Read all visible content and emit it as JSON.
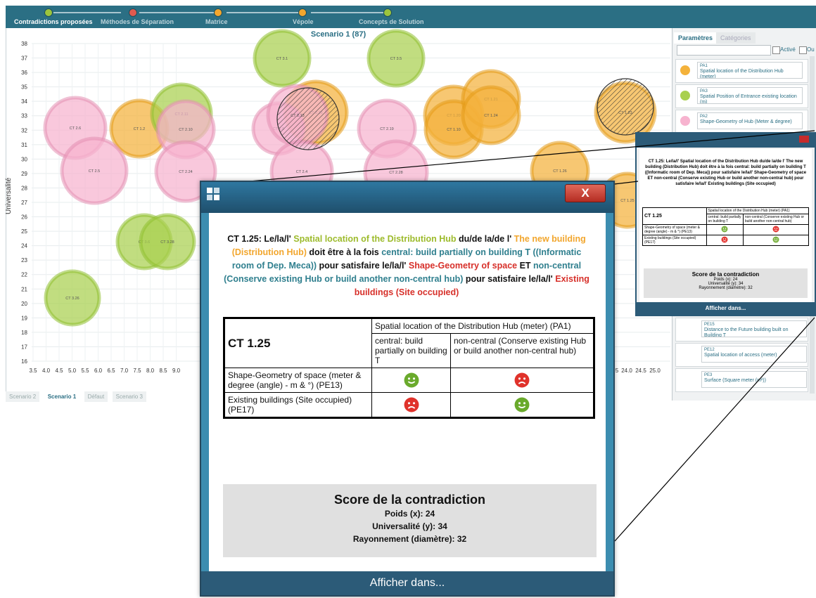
{
  "steps": [
    {
      "label": "Contradictions proposées",
      "color": "#9bc53d",
      "active": true
    },
    {
      "label": "Méthodes de Séparation",
      "color": "#e05a4f",
      "active": false
    },
    {
      "label": "Matrice",
      "color": "#f2a62d",
      "active": false
    },
    {
      "label": "Vépole",
      "color": "#f2a62d",
      "active": false
    },
    {
      "label": "Concepts de Solution",
      "color": "#9bc53d",
      "active": false
    }
  ],
  "chart": {
    "title": "Scenario 1 (87)",
    "ylabel": "Universalité",
    "yticks": [
      "16",
      "17",
      "18",
      "19",
      "20",
      "21",
      "22",
      "23",
      "24",
      "25",
      "26",
      "27",
      "28",
      "29",
      "30",
      "31",
      "32",
      "33",
      "34",
      "35",
      "36",
      "37",
      "38"
    ],
    "xticks": [
      "3.5",
      "4.0",
      "4.5",
      "5.0",
      "5.5",
      "6.0",
      "6.5",
      "7.0",
      "7.5",
      "8.0",
      "8.5",
      "9.0"
    ],
    "xticks_right": [
      "24.0",
      "24.5",
      "25.0"
    ],
    "xtick_partial": "5",
    "colors": {
      "green": "#a9d04f",
      "orange": "#f4b23b",
      "pink": "#f7b3cf"
    },
    "bubbles": [
      {
        "label": "CT 2.6",
        "color": "pink"
      },
      {
        "label": "CT 1.2",
        "color": "orange"
      },
      {
        "label": "CT 2.11",
        "color": "green"
      },
      {
        "label": "CT 2.10",
        "color": "pink"
      },
      {
        "label": "CT 3.1",
        "color": "green"
      },
      {
        "label": "CT 2.25",
        "color": "orange"
      },
      {
        "label": "CT 2.8",
        "color": "pink"
      },
      {
        "label": "CT 3.5",
        "color": "green"
      },
      {
        "label": "CT 2.13",
        "color": "pink"
      },
      {
        "label": "CT 2.19",
        "color": "pink"
      },
      {
        "label": "CT 1.20",
        "color": "orange"
      },
      {
        "label": "CT 1.10",
        "color": "orange"
      },
      {
        "label": "CT 1.21",
        "color": "orange"
      },
      {
        "label": "CT 1.24",
        "color": "orange"
      },
      {
        "label": "CT 1.23",
        "color": "orange"
      },
      {
        "label": "CT 2.5",
        "color": "pink"
      },
      {
        "label": "CT 2.24",
        "color": "pink"
      },
      {
        "label": "CT 2.4",
        "color": "pink"
      },
      {
        "label": "CT 2.28",
        "color": "pink"
      },
      {
        "label": "CT 1.26",
        "color": "orange"
      },
      {
        "label": "CT 1.25",
        "color": "orange"
      },
      {
        "label": "CT 3.6",
        "color": "green"
      },
      {
        "label": "CT 3.26",
        "color": "green"
      },
      {
        "label": "CT 3.28",
        "color": "green"
      }
    ]
  },
  "scenario_tabs": [
    "Scenario 2",
    "Scenario 1",
    "Défaut",
    "Scenario 3"
  ],
  "right_panel": {
    "tabs": [
      "Paramètres",
      "Catégories"
    ],
    "check_labels": [
      "Activé",
      "Ou"
    ],
    "params": [
      {
        "code": "PA1",
        "text": "Spatial location of the Distribution Hub (meter)",
        "color": "#f4b23b"
      },
      {
        "code": "PA3",
        "text": "Spatial Position of Entrance existing location (m)",
        "color": "#a9d04f"
      },
      {
        "code": "PA2",
        "text": "Shape-Geometry of Hub (Meter & degree)",
        "color": "#f7b3cf"
      }
    ],
    "pe_items": [
      {
        "code": "PE15",
        "text": "Distance to the Future building built on Building T"
      },
      {
        "code": "PE12",
        "text": "Spatial location of access (meter)"
      },
      {
        "code": "PE3",
        "text": "Surface (Square meter (m²))"
      }
    ]
  },
  "popup": {
    "close_label": "X",
    "ct_id": "CT 1.25",
    "text": [
      {
        "t": "CT 1.25: Le/la/l' ",
        "c": ""
      },
      {
        "t": "Spatial location of the Distribution Hub",
        "c": "tg"
      },
      {
        "t": " du/de la/de l' ",
        "c": ""
      },
      {
        "t": "The new building (Distribution Hub)",
        "c": "to"
      },
      {
        "t": " doit être à la fois ",
        "c": ""
      },
      {
        "t": "central: build partially on building T ((Informatic room of Dep. Meca))",
        "c": "tb"
      },
      {
        "t": " pour satisfaire le/la/l' ",
        "c": ""
      },
      {
        "t": "Shape-Geometry of space",
        "c": "tr"
      },
      {
        "t": " ET ",
        "c": ""
      },
      {
        "t": "non-central (Conserve existing Hub or build another non-central hub)",
        "c": "tb"
      },
      {
        "t": " pour satisfaire le/la/l' ",
        "c": ""
      },
      {
        "t": "Existing buildings (Site occupied)",
        "c": "tr"
      }
    ],
    "param_header": "Spatial location of the Distribution Hub (meter) (PA1)",
    "col1": "central: build partially on building T",
    "col2": "non-central (Conserve existing Hub or build another non-central hub)",
    "row1": "Shape-Geometry of space (meter & degree (angle) - m & °) (PE13)",
    "row2": "Existing buildings (Site occupied) (PE17)",
    "row1_faces": [
      "happy",
      "sad"
    ],
    "row2_faces": [
      "sad",
      "happy"
    ],
    "score_title": "Score de la contradiction",
    "poids": "Poids (x): 24",
    "universalite": "Universalité (y): 34",
    "rayonnement": "Rayonnement (diamètre): 32",
    "footer": "Afficher dans..."
  },
  "small_popup": {
    "text": "CT 1.25: Le/la/l' Spatial location of the Distribution Hub du/de la/de l' The new building (Distribution Hub) doit être à la fois central: build partially on building T ((Informatic room of Dep. Meca)) pour satisfaire le/la/l' Shape-Geometry of space ET non-central (Conserve existing Hub or build another non-central hub) pour satisfaire le/la/l' Existing buildings (Site occupied)",
    "ct_id": "CT 1.25",
    "param_header": "Spatial location of the Distribution Hub (meter) (PA1)",
    "col1": "central: build partially on building T",
    "col2": "non-central (Conserve existing Hub or build another non-central hub)",
    "row1": "Shape-Geometry of space (meter & degree (angle) - m & °) (PE13)",
    "row2": "Existing buildings (Site occupied) (PE17)",
    "score_title": "Score de la contradiction",
    "poids": "Poids (x): 24",
    "universalite": "Universalité (y): 34",
    "rayonnement": "Rayonnement (diamètre): 32",
    "footer": "Afficher dans..."
  }
}
